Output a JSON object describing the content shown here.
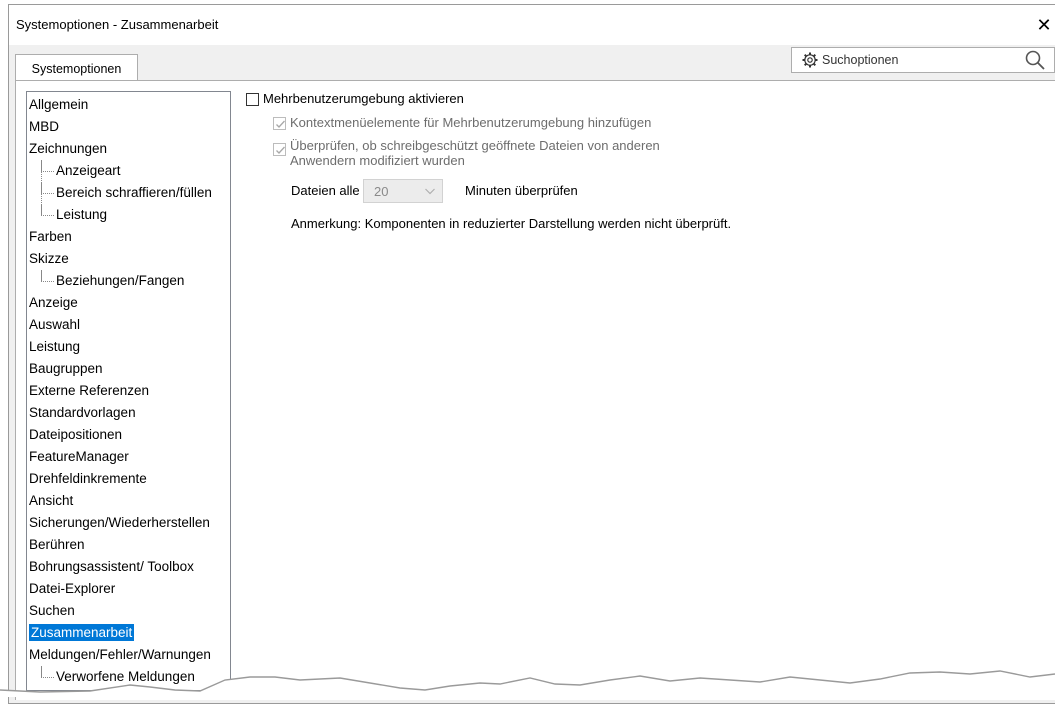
{
  "window": {
    "title": "Systemoptionen - Zusammenarbeit",
    "close_glyph": "✕"
  },
  "tabs": [
    {
      "label": "Systemoptionen"
    }
  ],
  "search": {
    "label": "Suchoptionen",
    "gear_icon": "gear-icon",
    "search_icon": "magnifier-icon"
  },
  "tree": {
    "items": [
      {
        "label": "Allgemein",
        "level": 0
      },
      {
        "label": "MBD",
        "level": 0
      },
      {
        "label": "Zeichnungen",
        "level": 0
      },
      {
        "label": "Anzeigeart",
        "level": 1
      },
      {
        "label": "Bereich schraffieren/füllen",
        "level": 1
      },
      {
        "label": "Leistung",
        "level": 1
      },
      {
        "label": "Farben",
        "level": 0
      },
      {
        "label": "Skizze",
        "level": 0
      },
      {
        "label": "Beziehungen/Fangen",
        "level": 1
      },
      {
        "label": "Anzeige",
        "level": 0
      },
      {
        "label": "Auswahl",
        "level": 0
      },
      {
        "label": "Leistung",
        "level": 0
      },
      {
        "label": "Baugruppen",
        "level": 0
      },
      {
        "label": "Externe Referenzen",
        "level": 0
      },
      {
        "label": "Standardvorlagen",
        "level": 0
      },
      {
        "label": "Dateipositionen",
        "level": 0
      },
      {
        "label": "FeatureManager",
        "level": 0
      },
      {
        "label": "Drehfeldinkremente",
        "level": 0
      },
      {
        "label": "Ansicht",
        "level": 0
      },
      {
        "label": "Sicherungen/Wiederherstellen",
        "level": 0
      },
      {
        "label": "Berühren",
        "level": 0
      },
      {
        "label": "Bohrungsassistent/ Toolbox",
        "level": 0
      },
      {
        "label": "Datei-Explorer",
        "level": 0
      },
      {
        "label": "Suchen",
        "level": 0
      },
      {
        "label": "Zusammenarbeit",
        "level": 0,
        "selected": true
      },
      {
        "label": "Meldungen/Fehler/Warnungen",
        "level": 0
      },
      {
        "label": "Verworfene Meldungen",
        "level": 1
      }
    ]
  },
  "options": {
    "multiuser": {
      "label": "Mehrbenutzerumgebung aktivieren",
      "checked": false
    },
    "context_menu": {
      "label": "Kontextmenüelemente für Mehrbenutzerumgebung hinzufügen",
      "checked": true,
      "enabled": false
    },
    "check_modified": {
      "label_line1": "Überprüfen, ob schreibgeschützt geöffnete Dateien von anderen",
      "label_line2": "Anwendern modifiziert wurden",
      "checked": true,
      "enabled": false
    },
    "interval": {
      "prefix": "Dateien alle",
      "value": "20",
      "suffix": "Minuten überprüfen"
    },
    "note": "Anmerkung: Komponenten in reduzierter Darstellung werden nicht überprüft."
  },
  "colors": {
    "selection": "#0078d7",
    "disabled_text": "#6d6d6d",
    "window_bg": "#f0f0f0"
  }
}
